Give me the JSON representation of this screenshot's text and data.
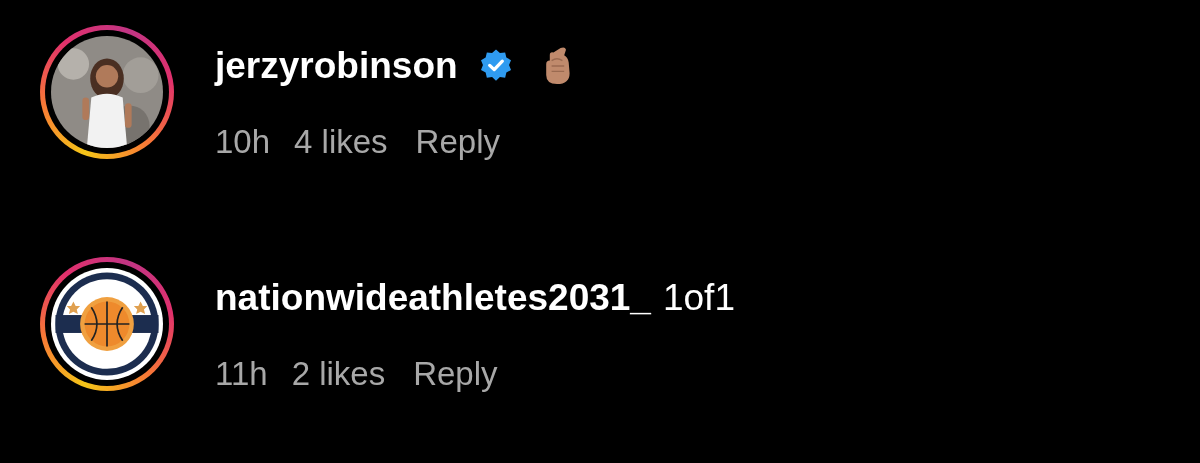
{
  "comments": [
    {
      "story_ring": true,
      "username": "jerzyrobinson",
      "verified": true,
      "hand_emoji": true,
      "time": "10h",
      "likes": "4 likes",
      "reply": "Reply"
    },
    {
      "story_ring": true,
      "username": "nationwideathletes2031_",
      "verified": false,
      "hand_emoji": false,
      "text": "1of1",
      "time": "11h",
      "likes": "2 likes",
      "reply": "Reply"
    }
  ]
}
